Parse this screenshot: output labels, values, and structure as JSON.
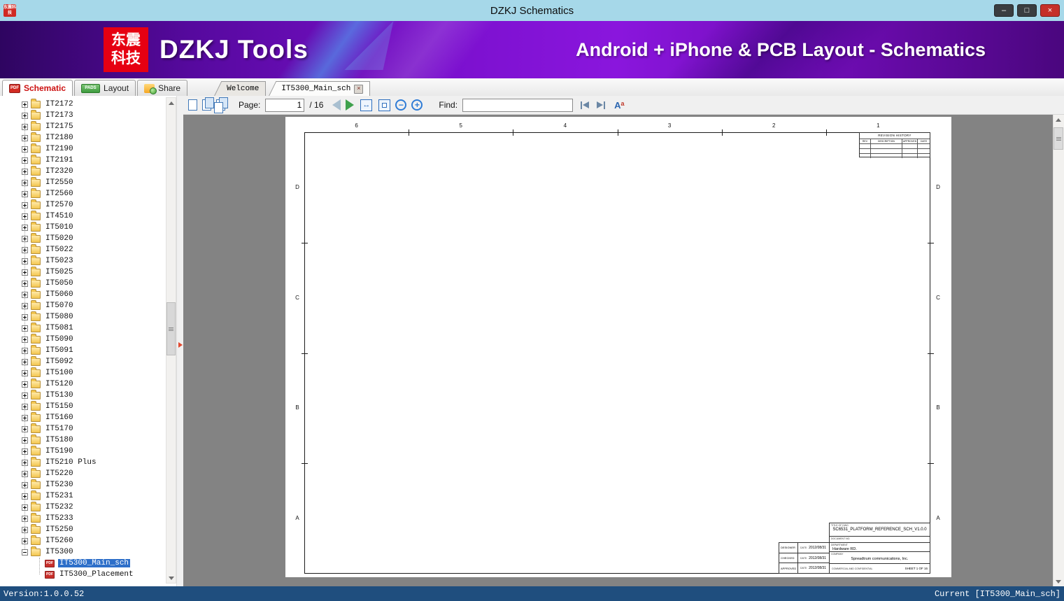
{
  "window": {
    "title": "DZKJ Schematics",
    "app_icon_text": "东震科技",
    "minimize": "–",
    "maximize": "□",
    "close": "×"
  },
  "banner": {
    "logo_top": "东震",
    "logo_bottom": "科技",
    "app_name": "DZKJ Tools",
    "tagline": "Android + iPhone & PCB Layout - Schematics"
  },
  "tabs": {
    "close_glyph": "×",
    "app": [
      {
        "label": "Schematic",
        "icon": "PDF",
        "active": true
      },
      {
        "label": "Layout",
        "icon": "PADS",
        "active": false
      },
      {
        "label": "Share",
        "icon": "share",
        "active": false
      }
    ],
    "docs": [
      {
        "label": "Welcome",
        "active": false,
        "closable": false
      },
      {
        "label": "IT5300_Main_sch",
        "active": true,
        "closable": true
      }
    ]
  },
  "toolbar": {
    "page_label": "Page:",
    "page_value": "1",
    "page_total": "/ 16",
    "find_label": "Find:",
    "find_value": "",
    "icons": {
      "zoom_out": "−",
      "zoom_in": "+",
      "fit_width": "↔",
      "match_case_big": "A",
      "match_case_small": "a"
    }
  },
  "sidebar": {
    "pdf_badge": "PDF",
    "tree": [
      {
        "label": "IT2172"
      },
      {
        "label": "IT2173"
      },
      {
        "label": "IT2175"
      },
      {
        "label": "IT2180"
      },
      {
        "label": "IT2190"
      },
      {
        "label": "IT2191"
      },
      {
        "label": "IT2320"
      },
      {
        "label": "IT2550"
      },
      {
        "label": "IT2560"
      },
      {
        "label": "IT2570"
      },
      {
        "label": "IT4510"
      },
      {
        "label": "IT5010"
      },
      {
        "label": "IT5020"
      },
      {
        "label": "IT5022"
      },
      {
        "label": "IT5023"
      },
      {
        "label": "IT5025"
      },
      {
        "label": "IT5050"
      },
      {
        "label": "IT5060"
      },
      {
        "label": "IT5070"
      },
      {
        "label": "IT5080"
      },
      {
        "label": "IT5081"
      },
      {
        "label": "IT5090"
      },
      {
        "label": "IT5091"
      },
      {
        "label": "IT5092"
      },
      {
        "label": "IT5100"
      },
      {
        "label": "IT5120"
      },
      {
        "label": "IT5130"
      },
      {
        "label": "IT5150"
      },
      {
        "label": "IT5160"
      },
      {
        "label": "IT5170"
      },
      {
        "label": "IT5180"
      },
      {
        "label": "IT5190"
      },
      {
        "label": "IT5210 Plus"
      },
      {
        "label": "IT5220"
      },
      {
        "label": "IT5230"
      },
      {
        "label": "IT5231"
      },
      {
        "label": "IT5232"
      },
      {
        "label": "IT5233"
      },
      {
        "label": "IT5250"
      },
      {
        "label": "IT5260"
      },
      {
        "label": "IT5300",
        "expanded": true,
        "children": [
          {
            "label": "IT5300_Main_sch",
            "selected": true
          },
          {
            "label": "IT5300_Placement",
            "selected": false
          }
        ]
      }
    ]
  },
  "sheet": {
    "column_labels": [
      "6",
      "5",
      "4",
      "3",
      "2",
      "1"
    ],
    "row_labels": [
      "D",
      "C",
      "B",
      "A"
    ],
    "revision_table": {
      "title": "REVISION HISTORY",
      "headers": [
        "REV",
        "DESCRIPTION",
        "APPROVED",
        "DATE"
      ]
    },
    "title_block": {
      "title_label": "TITLE OF DWG",
      "title": "SC6531_PLATFORM_REFERENCE_SCH_V1.0.0",
      "doc_no_label": "DOCUMENT NO.",
      "dept_label": "DEPARTMENT",
      "department": "Hardware RD.",
      "company_label": "COMPANY",
      "company": "Spreadtrum communications, Inc.",
      "sign_rows": [
        {
          "label": "DESIGNER",
          "date_label": "DATE:",
          "date": "2012/08/31"
        },
        {
          "label": "CHECKED",
          "date_label": "DATE:",
          "date": "2012/08/31"
        },
        {
          "label": "APPROVED",
          "date_label": "DATE:",
          "date": "2012/08/31"
        }
      ],
      "confidential": "COMMERCIAL AND CONFIDENTIAL",
      "sheet_label": "SHEET 1 OF 16"
    }
  },
  "statusbar": {
    "version": "Version:1.0.0.52",
    "current": "Current [IT5300_Main_sch]"
  }
}
